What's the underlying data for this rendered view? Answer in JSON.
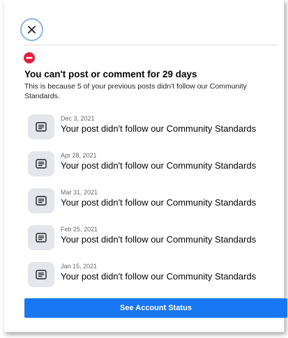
{
  "header": {
    "close_icon": "close-icon"
  },
  "notice": {
    "icon": "stop-icon",
    "icon_color": "#e41e3f",
    "title": "You can't post or comment for 29 days",
    "description": "This is because 5 of your previous posts didn't follow our Community Standards."
  },
  "violations": [
    {
      "date": "Dec 3, 2021",
      "text": "Your post didn't follow our Community Standards",
      "icon": "post-icon"
    },
    {
      "date": "Apr 28, 2021",
      "text": "Your post didn't follow our Community Standards",
      "icon": "post-icon"
    },
    {
      "date": "Mar 31, 2021",
      "text": "Your post didn't follow our Community Standards",
      "icon": "post-icon"
    },
    {
      "date": "Feb 25, 2021",
      "text": "Your post didn't follow our Community Standards",
      "icon": "post-icon"
    },
    {
      "date": "Jan 15, 2021",
      "text": "Your post didn't follow our Community Standards",
      "icon": "post-icon"
    }
  ],
  "footer": {
    "button_label": "See Account Status",
    "button_color": "#1877f2"
  }
}
